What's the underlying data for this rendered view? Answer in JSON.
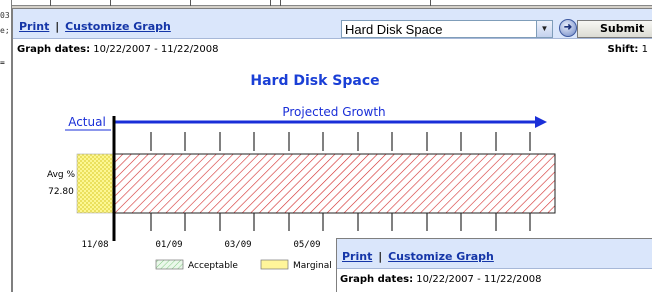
{
  "background_window": {
    "left_fragments": [
      "03",
      "e;"
    ],
    "scrollbar_mark": "="
  },
  "toolbar": {
    "print_label": "Print",
    "separator": "|",
    "customize_label": "Customize Graph",
    "graph_select": {
      "value": "Hard Disk Space"
    },
    "submit_label": "Submit"
  },
  "date_info": {
    "label": "Graph dates:",
    "range": "10/22/2007 - 11/22/2008",
    "shift_label": "Shift:",
    "shift_value": "1"
  },
  "chart_data": {
    "type": "bar",
    "title": "Hard Disk Space",
    "actual_label": "Actual",
    "projection_label": "Projected Growth",
    "ylabel": "Avg %",
    "value_label": "72.80",
    "x_ticks": [
      "11/08",
      "01/09",
      "03/09",
      "05/09"
    ],
    "segments": [
      {
        "name": "Marginal",
        "span": "actual",
        "color": "#fffa9a"
      },
      {
        "name": "Acceptable",
        "span": "projected",
        "color": "#ff8a8a"
      }
    ],
    "legend": [
      {
        "name": "Acceptable",
        "color": "#c3e8c3"
      },
      {
        "name": "Marginal",
        "color": "#fff59a"
      }
    ],
    "colors": {
      "title": "#1a3fd6",
      "arrow": "#1a2fd8",
      "hatch": "#d22a2a"
    }
  },
  "front_window": {
    "print_label": "Print",
    "separator": "|",
    "customize_label": "Customize Graph",
    "date_label": "Graph dates:",
    "date_range": "10/22/2007 - 11/22/2008"
  }
}
